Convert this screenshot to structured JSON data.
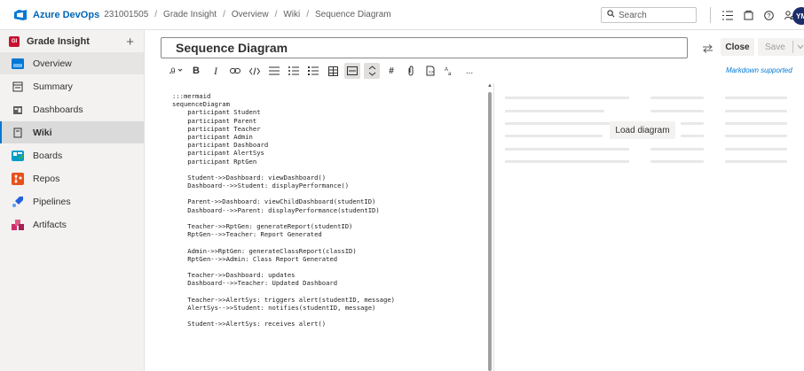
{
  "header": {
    "brand": "Azure DevOps",
    "org": "231001505",
    "breadcrumbs": [
      "Grade Insight",
      "Overview",
      "Wiki",
      "Sequence Diagram"
    ],
    "search_placeholder": "Search",
    "avatar_initials": "YM"
  },
  "sidebar": {
    "project_badge": "GI",
    "project_name": "Grade Insight",
    "add_label": "+",
    "items": [
      {
        "label": "Overview",
        "icon": "overview-icon"
      },
      {
        "label": "Summary",
        "icon": "summary-icon"
      },
      {
        "label": "Dashboards",
        "icon": "dashboards-icon"
      },
      {
        "label": "Wiki",
        "icon": "wiki-icon"
      },
      {
        "label": "Boards",
        "icon": "boards-icon"
      },
      {
        "label": "Repos",
        "icon": "repos-icon"
      },
      {
        "label": "Pipelines",
        "icon": "pipelines-icon"
      },
      {
        "label": "Artifacts",
        "icon": "artifacts-icon"
      }
    ]
  },
  "page": {
    "title": "Sequence Diagram",
    "close_label": "Close",
    "save_label": "Save",
    "markdown_link": "Markdown supported",
    "load_diagram": "Load diagram"
  },
  "toolbar": {
    "buttons": [
      "heading",
      "B",
      "I",
      "link",
      "code",
      "ul",
      "ol",
      "task",
      "table",
      "image",
      "mermaid",
      "hash",
      "attach",
      "code-block",
      "format",
      "..."
    ]
  },
  "editor": {
    "lines": [
      ":::mermaid",
      "sequenceDiagram",
      "    participant Student",
      "    participant Parent",
      "    participant Teacher",
      "    participant Admin",
      "    participant Dashboard",
      "    participant AlertSys",
      "    participant RptGen",
      "",
      "    Student->>Dashboard: viewDashboard()",
      "    Dashboard-->>Student: displayPerformance()",
      "",
      "    Parent->>Dashboard: viewChildDashboard(studentID)",
      "    Dashboard-->>Parent: displayPerformance(studentID)",
      "",
      "    Teacher->>RptGen: generateReport(studentID)",
      "    RptGen-->>Teacher: Report Generated",
      "",
      "    Admin->>RptGen: generateClassReport(classID)",
      "    RptGen-->>Admin: Class Report Generated",
      "",
      "    Teacher->>Dashboard: updates",
      "    Dashboard-->>Teacher: Updated Dashboard",
      "",
      "    Teacher->>AlertSys: triggers alert(studentID, message)",
      "    AlertSys-->>Student: notifies(studentID, message)",
      "",
      "    Student->>AlertSys: receives alert()"
    ]
  },
  "colors": {
    "brand": "#0066b8",
    "accent": "#0078d4",
    "avatar_bg": "#1c2d6b",
    "project_badge": "#c8102e"
  }
}
